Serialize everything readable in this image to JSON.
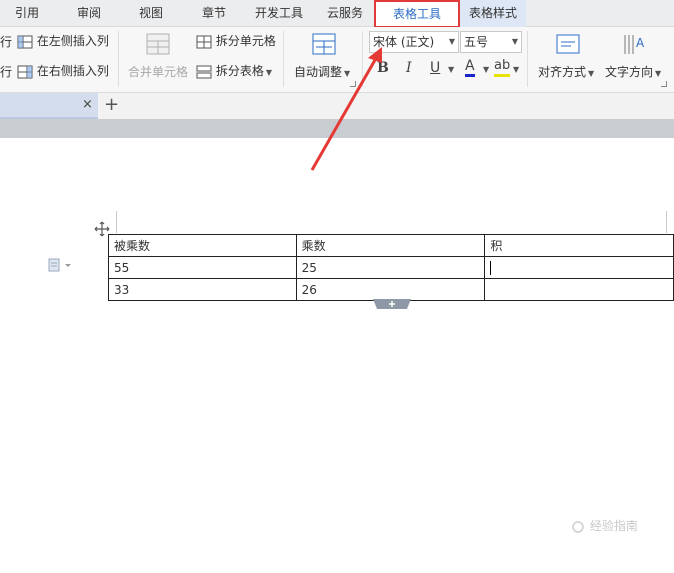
{
  "menu_tabs": [
    "引用",
    "审阅",
    "视图",
    "章节",
    "开发工具",
    "云服务",
    "表格工具",
    "表格样式"
  ],
  "ribbon": {
    "insert_left_row": "行",
    "insert_left_col": "在左侧插入列",
    "insert_right_row": "行",
    "insert_right_col": "在右侧插入列",
    "merge_cells": "合并单元格",
    "split_cells": "拆分单元格",
    "split_table": "拆分表格",
    "auto_fit": "自动调整",
    "font_name": "宋体 (正文)",
    "font_size": "五号",
    "bold": "B",
    "italic": "I",
    "underline": "U",
    "font_color": "A",
    "highlight": "ab",
    "align": "对齐方式",
    "text_direction": "文字方向"
  },
  "doc_tab": {
    "close": "×",
    "new": "+"
  },
  "table": {
    "header": [
      "被乘数",
      "乘数",
      "积"
    ],
    "rows": [
      [
        "55",
        "25",
        ""
      ],
      [
        "33",
        "26",
        ""
      ]
    ]
  },
  "watermark": "经验指南",
  "colors": {
    "accent": "#2b6cc4",
    "highlight_border": "#e03a3a",
    "annotation_arrow": "#e53935"
  }
}
